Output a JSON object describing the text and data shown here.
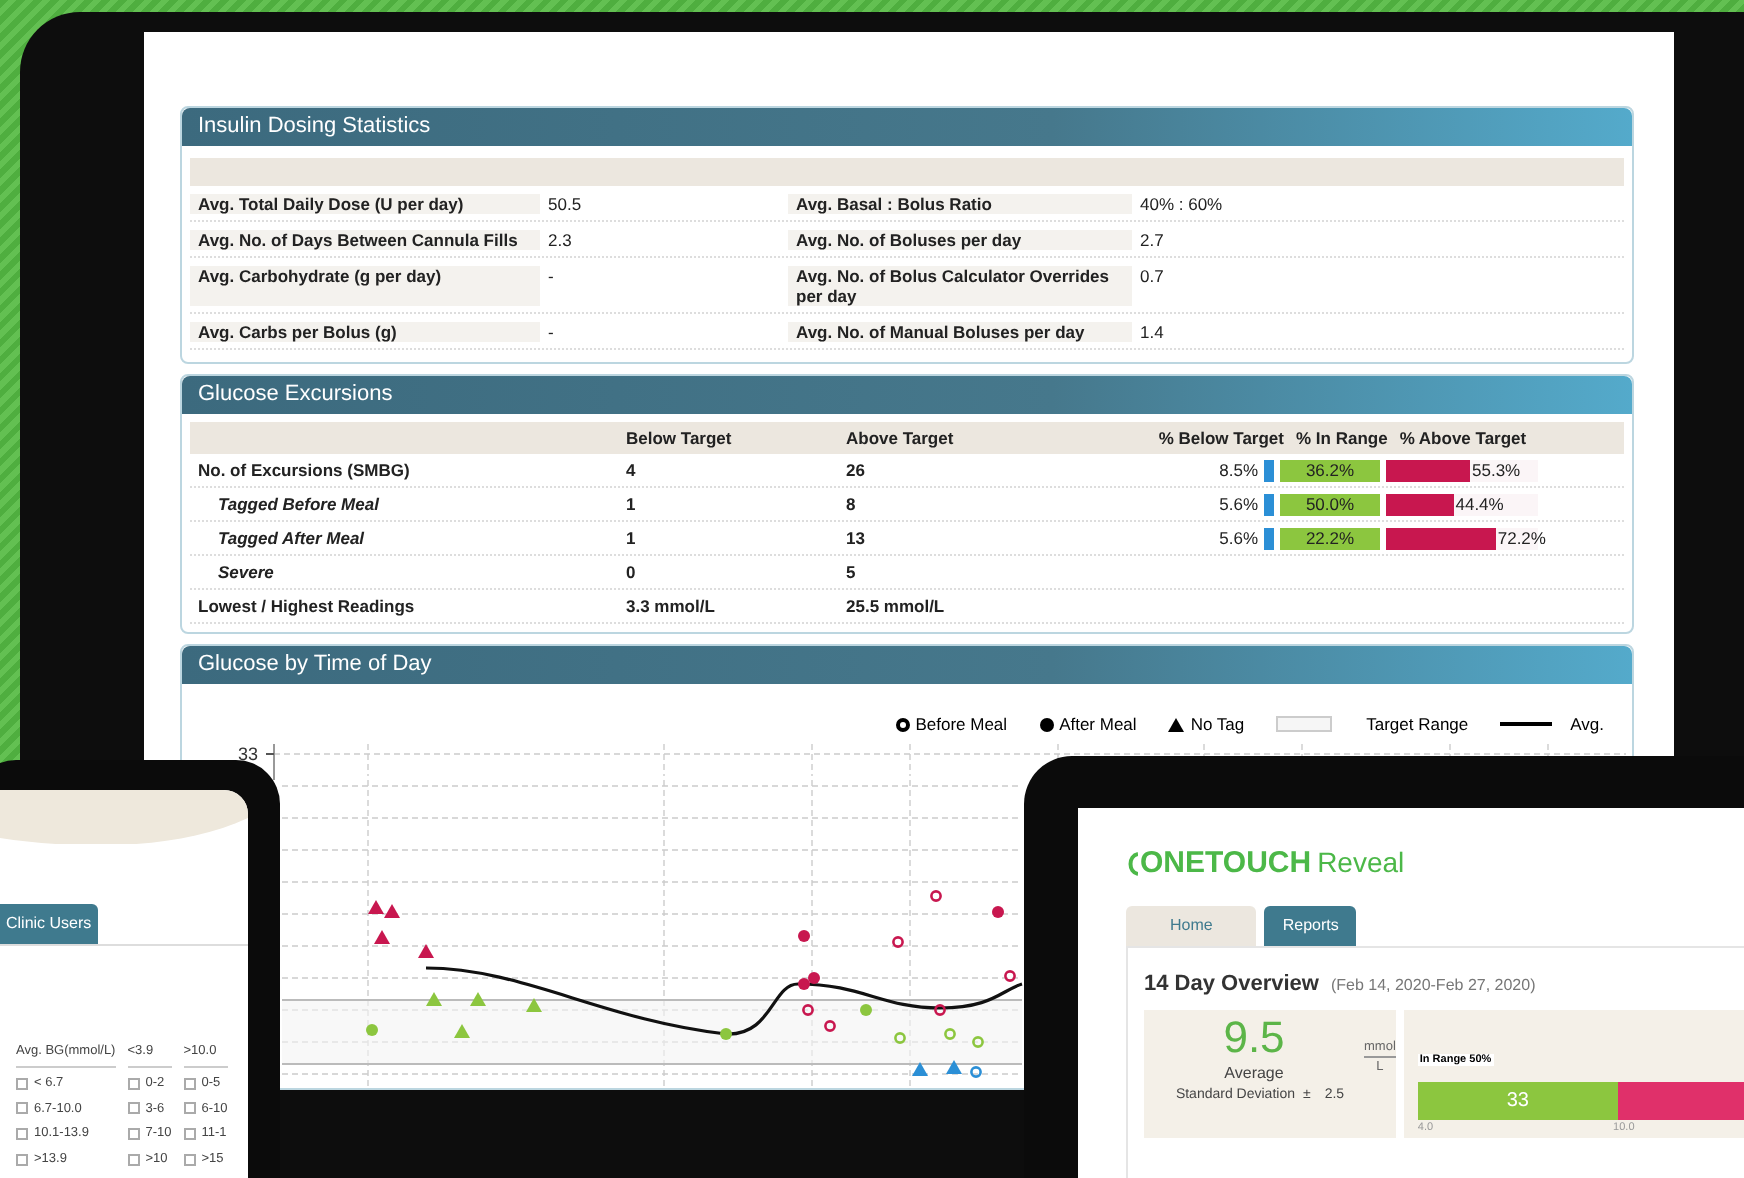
{
  "insulin_dosing": {
    "title": "Insulin Dosing Statistics",
    "rows": [
      {
        "label": "Avg. Total Daily Dose (U per day)",
        "value": "50.5",
        "label_2": "Avg. Basal : Bolus Ratio",
        "value_2": "40% : 60%"
      },
      {
        "label": "Avg. No. of Days Between Cannula Fills",
        "value": "2.3",
        "label_2": "Avg. No. of Boluses per day",
        "value_2": "2.7"
      },
      {
        "label": "Avg. Carbohydrate (g per day)",
        "value": "-",
        "label_2": "Avg. No. of Bolus Calculator Overrides per day",
        "value_2": "0.7"
      },
      {
        "label": "Avg. Carbs per Bolus (g)",
        "value": "-",
        "label_2": "Avg. No. of Manual Boluses per day",
        "value_2": "1.4"
      }
    ]
  },
  "glucose_excursions": {
    "title": "Glucose Excursions",
    "columns": [
      "Below Target",
      "Above Target",
      "% Below Target",
      "% In Range",
      "% Above Target"
    ],
    "rows": [
      {
        "label": "No. of Excursions (SMBG)",
        "below": "4",
        "above": "26",
        "pct_below": "8.5%",
        "pct_in": "36.2%",
        "pct_above": "55.3%",
        "level": 0.553,
        "children": [
          {
            "label": "Tagged Before Meal",
            "below": "1",
            "above": "8",
            "pct_below": "5.6%",
            "pct_in": "50.0%",
            "pct_above": "44.4%",
            "level": 0.444
          },
          {
            "label": "Tagged After Meal",
            "below": "1",
            "above": "13",
            "pct_below": "5.6%",
            "pct_in": "22.2%",
            "pct_above": "72.2%",
            "level": 0.722
          },
          {
            "label": "Severe",
            "below": "0",
            "above": "5"
          }
        ]
      },
      {
        "label": "Lowest / Highest Readings",
        "below": "3.3 mmol/L",
        "above": "25.5 mmol/L"
      }
    ]
  },
  "glucose_by_time": {
    "title": "Glucose by Time of Day",
    "y_tick": "33",
    "legend": [
      {
        "kind": "before_meal",
        "label": "Before Meal"
      },
      {
        "kind": "after_meal",
        "label": "After Meal"
      },
      {
        "kind": "no_tag",
        "label": "No Tag"
      },
      {
        "kind": "target_range",
        "label": "Target Range"
      },
      {
        "kind": "average",
        "label": "Avg."
      }
    ]
  },
  "tablet": {
    "tab": "Clinic Users",
    "columns": [
      {
        "heading": "Avg. BG(mmol/L)",
        "options": [
          {
            "label": "< 6.7",
            "checked": false
          },
          {
            "label": "6.7-10.0",
            "checked": false
          },
          {
            "label": "10.1-13.9",
            "checked": false
          },
          {
            "label": ">13.9",
            "checked": false
          }
        ]
      },
      {
        "heading": "<3.9",
        "options": [
          {
            "label": "0-2",
            "checked": false
          },
          {
            "label": "3-6",
            "checked": false
          },
          {
            "label": "7-10",
            "checked": false
          },
          {
            "label": ">10",
            "checked": false
          }
        ]
      },
      {
        "heading": ">10.0",
        "options": [
          {
            "label": "0-5",
            "checked": false
          },
          {
            "label": "6-10",
            "checked": false
          },
          {
            "label": "11-1",
            "checked": false
          },
          {
            "label": ">15",
            "checked": false
          }
        ]
      }
    ]
  },
  "overview_app": {
    "logo": {
      "brand": "ONETOUCH",
      "product": "Reveal"
    },
    "tabs": [
      {
        "label": "Home",
        "selected": false
      },
      {
        "label": "Reports",
        "selected": true
      }
    ],
    "title": "14 Day Overview",
    "date_range": "(Feb 14, 2020-Feb 27, 2020)",
    "average": {
      "value": "9.5",
      "unit_top": "mmol",
      "unit_bottom": "L",
      "label": "Average",
      "sd_label": "Standard Deviation",
      "sd_sign": "±",
      "sd_value": "2.5"
    },
    "range": {
      "label": "In Range 50%",
      "value": "33",
      "level": 0.5,
      "ticks": [
        "4.0",
        "10.0"
      ]
    }
  }
}
